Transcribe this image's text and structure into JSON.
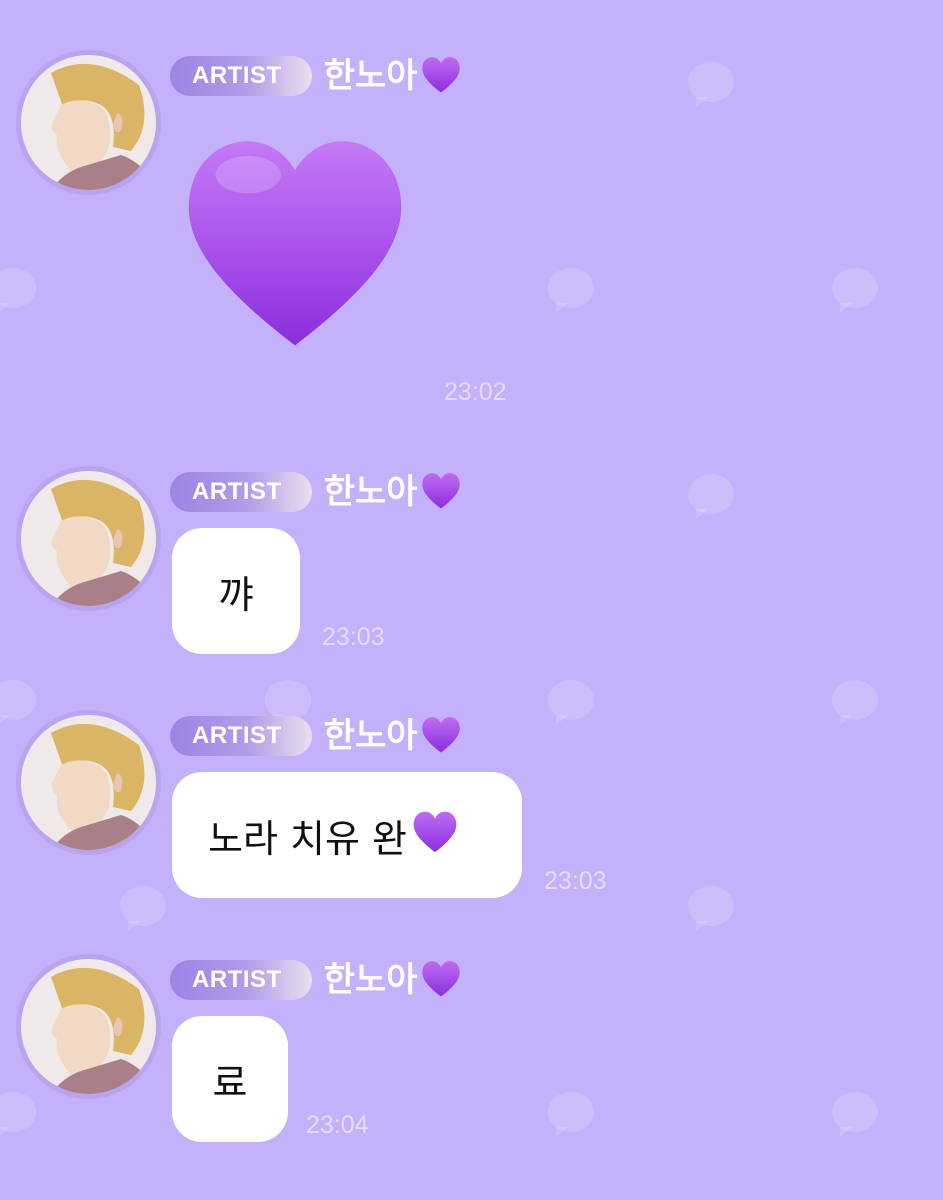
{
  "sender": {
    "badge": "ARTIST",
    "name": "한노아",
    "name_emoji": "purple-heart-icon"
  },
  "colors": {
    "background": "#c4b1fb",
    "bubble": "#ffffff",
    "badge_gradient_start": "#9b84e6",
    "heart": "#9b3fe6"
  },
  "messages": [
    {
      "type": "emoji",
      "emoji": "purple-heart-icon",
      "time": "23:02"
    },
    {
      "type": "text",
      "text": "꺄",
      "time": "23:03"
    },
    {
      "type": "text",
      "text": "노라 치유 완",
      "trailing_emoji": "purple-heart-icon",
      "time": "23:03"
    },
    {
      "type": "text",
      "text": "료",
      "time": "23:04"
    }
  ]
}
